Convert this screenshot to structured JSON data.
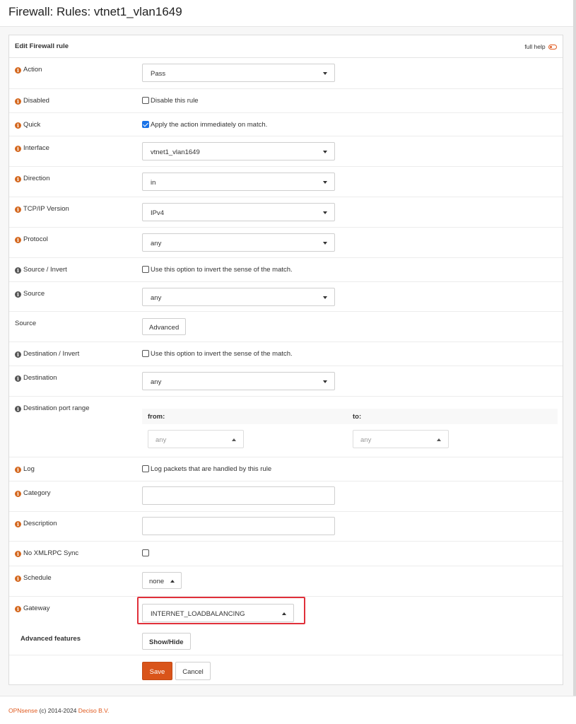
{
  "page": {
    "title": "Firewall: Rules: vtnet1_vlan1649"
  },
  "panel": {
    "header": "Edit Firewall rule",
    "full_help": "full help"
  },
  "fields": {
    "action": {
      "label": "Action",
      "value": "Pass"
    },
    "disabled": {
      "label": "Disabled",
      "checkbox_label": "Disable this rule",
      "checked": false
    },
    "quick": {
      "label": "Quick",
      "checkbox_label": "Apply the action immediately on match.",
      "checked": true
    },
    "interface": {
      "label": "Interface",
      "value": "vtnet1_vlan1649"
    },
    "direction": {
      "label": "Direction",
      "value": "in"
    },
    "tcpip_version": {
      "label": "TCP/IP Version",
      "value": "IPv4"
    },
    "protocol": {
      "label": "Protocol",
      "value": "any"
    },
    "source_invert": {
      "label": "Source / Invert",
      "checkbox_label": "Use this option to invert the sense of the match.",
      "checked": false
    },
    "source": {
      "label": "Source",
      "value": "any"
    },
    "source_advanced": {
      "label": "Source",
      "button_label": "Advanced"
    },
    "destination_invert": {
      "label": "Destination / Invert",
      "checkbox_label": "Use this option to invert the sense of the match.",
      "checked": false
    },
    "destination": {
      "label": "Destination",
      "value": "any"
    },
    "dest_port_range": {
      "label": "Destination port range",
      "from_label": "from:",
      "to_label": "to:",
      "from_value": "any",
      "to_value": "any"
    },
    "log": {
      "label": "Log",
      "checkbox_label": "Log packets that are handled by this rule",
      "checked": false
    },
    "category": {
      "label": "Category",
      "value": ""
    },
    "description": {
      "label": "Description",
      "value": ""
    },
    "no_xmlrpc_sync": {
      "label": "No XMLRPC Sync",
      "checked": false
    },
    "schedule": {
      "label": "Schedule",
      "value": "none"
    },
    "gateway": {
      "label": "Gateway",
      "value": "INTERNET_LOADBALANCING"
    },
    "advanced_features": {
      "label": "Advanced features",
      "button_label": "Show/Hide"
    }
  },
  "actions": {
    "save": "Save",
    "cancel": "Cancel"
  },
  "footer": {
    "brand": "OPNsense",
    "copyright": " (c) 2014-2024 ",
    "company": "Deciso B.V."
  },
  "colors": {
    "accent": "#d9541a",
    "highlight": "#e0303a",
    "info_icon": "#d4681f"
  }
}
